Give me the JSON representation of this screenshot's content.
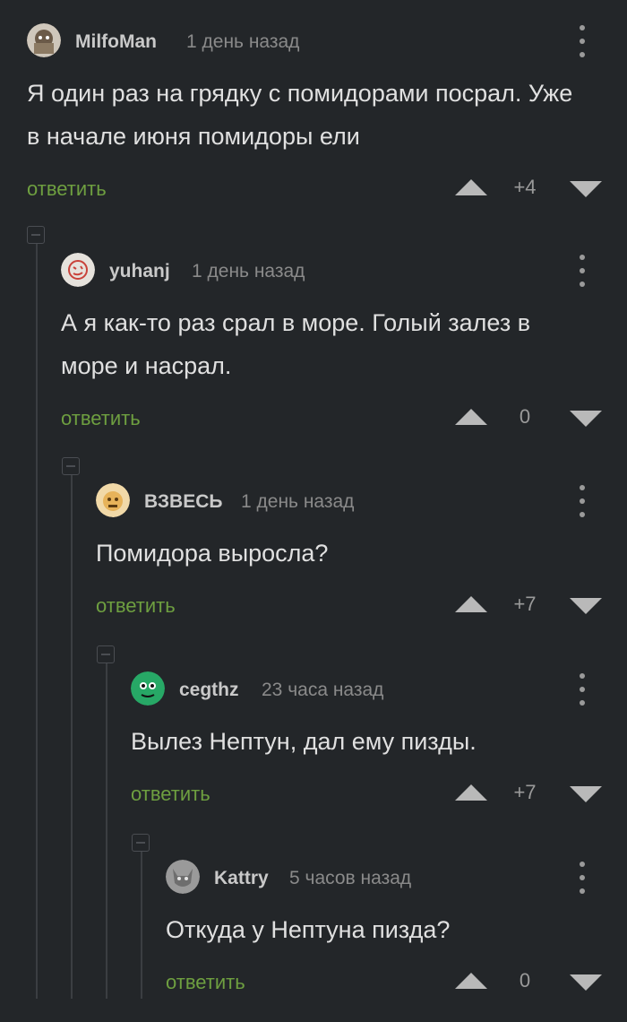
{
  "comments": [
    {
      "author": "MilfoMan",
      "time": "1 день назад",
      "text": "Я один раз на грядку с помидорами посрал. Уже в начале июня помидоры ели",
      "reply_label": "ответить",
      "score": "+4"
    },
    {
      "author": "yuhanj",
      "time": "1 день назад",
      "text": "А я как-то раз срал в море. Голый залез в море и насрал.",
      "reply_label": "ответить",
      "score": "0"
    },
    {
      "author": "ВЗВЕСЬ",
      "time": "1 день назад",
      "text": "Помидора выросла?",
      "reply_label": "ответить",
      "score": "+7"
    },
    {
      "author": "cegthz",
      "time": "23 часа назад",
      "text": "Вылез Нептун, дал ему пизды.",
      "reply_label": "ответить",
      "score": "+7"
    },
    {
      "author": "Kattry",
      "time": "5 часов назад",
      "text": "Откуда у Нептуна пизда?",
      "reply_label": "ответить",
      "score": "0"
    }
  ],
  "colors": {
    "background": "#232629",
    "reply_link": "#6e9f40",
    "thread_line": "#3b3e42"
  },
  "icons": [
    "more-vertical-icon",
    "upvote-icon",
    "downvote-icon",
    "collapse-thread-icon"
  ]
}
